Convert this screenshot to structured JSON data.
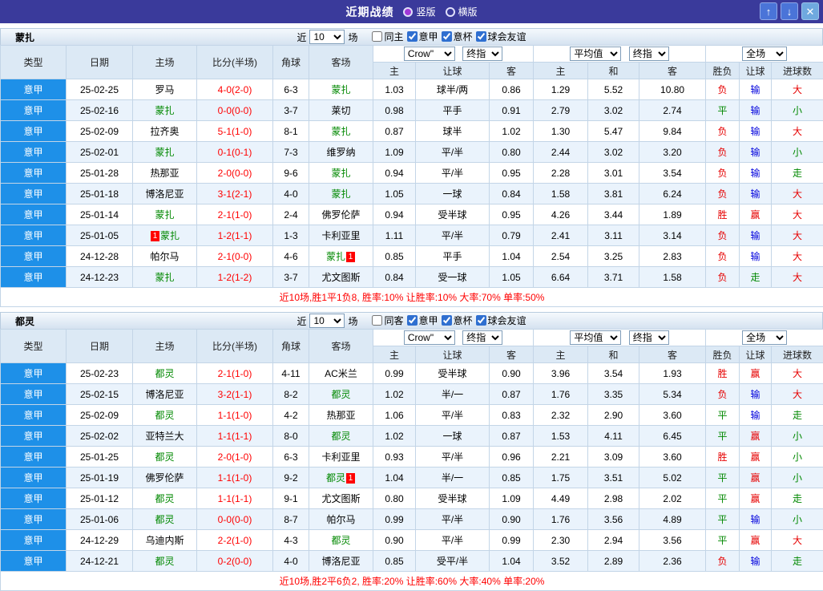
{
  "titlebar": {
    "title": "近期战绩",
    "view_options": [
      {
        "label": "竖版",
        "selected": true
      },
      {
        "label": "横版",
        "selected": false
      }
    ],
    "buttons": {
      "up": "↑",
      "down": "↓",
      "close": "✕"
    }
  },
  "shared": {
    "recent_label": "近",
    "matches_label": "场"
  },
  "columns": [
    "类型",
    "日期",
    "主场",
    "比分(半场)",
    "角球",
    "客场",
    "主",
    "让球",
    "客",
    "主",
    "和",
    "客",
    "胜负",
    "让球",
    "进球数"
  ],
  "colors": {
    "titlebar_bg": "#3A3A9B",
    "league_badge_bg": "#1E90E8",
    "subject_team": "#008800",
    "score_red": "#FF0000",
    "value_colors": {
      "胜": "#E60000",
      "平": "#008800",
      "负": "#E60000",
      "赢": "#E60000",
      "输": "#0000DD",
      "走": "#008800",
      "大": "#E60000",
      "小": "#008800"
    }
  },
  "sections": [
    {
      "team": "蒙扎",
      "filters": {
        "recent_value": "10",
        "checkboxes": [
          {
            "label": "同主",
            "checked": false
          },
          {
            "label": "意甲",
            "checked": true
          },
          {
            "label": "意杯",
            "checked": true
          },
          {
            "label": "球会友谊",
            "checked": true
          }
        ]
      },
      "dropdowns": {
        "handicap_company": "Crow\"",
        "handicap_time": "终指",
        "europe_type": "平均值",
        "europe_time": "终指",
        "scope": "全场"
      },
      "rows": [
        {
          "type": "意甲",
          "date": "25-02-25",
          "home": "罗马",
          "score": "4-0(2-0)",
          "corner": "6-3",
          "away": "蒙扎",
          "ah": [
            "1.03",
            "球半/两",
            "0.86"
          ],
          "eu": [
            "1.29",
            "5.52",
            "10.80"
          ],
          "res": [
            "负",
            "输",
            "大"
          ]
        },
        {
          "type": "意甲",
          "date": "25-02-16",
          "home": "蒙扎",
          "score": "0-0(0-0)",
          "corner": "3-7",
          "away": "莱切",
          "ah": [
            "0.98",
            "平手",
            "0.91"
          ],
          "eu": [
            "2.79",
            "3.02",
            "2.74"
          ],
          "res": [
            "平",
            "输",
            "小"
          ]
        },
        {
          "type": "意甲",
          "date": "25-02-09",
          "home": "拉齐奥",
          "score": "5-1(1-0)",
          "corner": "8-1",
          "away": "蒙扎",
          "ah": [
            "0.87",
            "球半",
            "1.02"
          ],
          "eu": [
            "1.30",
            "5.47",
            "9.84"
          ],
          "res": [
            "负",
            "输",
            "大"
          ]
        },
        {
          "type": "意甲",
          "date": "25-02-01",
          "home": "蒙扎",
          "score": "0-1(0-1)",
          "corner": "7-3",
          "away": "维罗纳",
          "ah": [
            "1.09",
            "平/半",
            "0.80"
          ],
          "eu": [
            "2.44",
            "3.02",
            "3.20"
          ],
          "res": [
            "负",
            "输",
            "小"
          ]
        },
        {
          "type": "意甲",
          "date": "25-01-28",
          "home": "热那亚",
          "score": "2-0(0-0)",
          "corner": "9-6",
          "away": "蒙扎",
          "ah": [
            "0.94",
            "平/半",
            "0.95"
          ],
          "eu": [
            "2.28",
            "3.01",
            "3.54"
          ],
          "res": [
            "负",
            "输",
            "走"
          ]
        },
        {
          "type": "意甲",
          "date": "25-01-18",
          "home": "博洛尼亚",
          "score": "3-1(2-1)",
          "corner": "4-0",
          "away": "蒙扎",
          "ah": [
            "1.05",
            "一球",
            "0.84"
          ],
          "eu": [
            "1.58",
            "3.81",
            "6.24"
          ],
          "res": [
            "负",
            "输",
            "大"
          ]
        },
        {
          "type": "意甲",
          "date": "25-01-14",
          "home": "蒙扎",
          "score": "2-1(1-0)",
          "corner": "2-4",
          "away": "佛罗伦萨",
          "ah": [
            "0.94",
            "受半球",
            "0.95"
          ],
          "eu": [
            "4.26",
            "3.44",
            "1.89"
          ],
          "res": [
            "胜",
            "赢",
            "大"
          ]
        },
        {
          "type": "意甲",
          "date": "25-01-05",
          "home": "蒙扎",
          "home_card": "1",
          "score": "1-2(1-1)",
          "corner": "1-3",
          "away": "卡利亚里",
          "ah": [
            "1.11",
            "平/半",
            "0.79"
          ],
          "eu": [
            "2.41",
            "3.11",
            "3.14"
          ],
          "res": [
            "负",
            "输",
            "大"
          ]
        },
        {
          "type": "意甲",
          "date": "24-12-28",
          "home": "帕尔马",
          "score": "2-1(0-0)",
          "corner": "4-6",
          "away": "蒙扎",
          "away_card": "1",
          "ah": [
            "0.85",
            "平手",
            "1.04"
          ],
          "eu": [
            "2.54",
            "3.25",
            "2.83"
          ],
          "res": [
            "负",
            "输",
            "大"
          ]
        },
        {
          "type": "意甲",
          "date": "24-12-23",
          "home": "蒙扎",
          "score": "1-2(1-2)",
          "corner": "3-7",
          "away": "尤文图斯",
          "ah": [
            "0.84",
            "受一球",
            "1.05"
          ],
          "eu": [
            "6.64",
            "3.71",
            "1.58"
          ],
          "res": [
            "负",
            "走",
            "大"
          ]
        }
      ],
      "summary": "近10场,胜1平1负8, 胜率:10% 让胜率:10% 大率:70% 单率:50%"
    },
    {
      "team": "都灵",
      "filters": {
        "recent_value": "10",
        "checkboxes": [
          {
            "label": "同客",
            "checked": false
          },
          {
            "label": "意甲",
            "checked": true
          },
          {
            "label": "意杯",
            "checked": true
          },
          {
            "label": "球会友谊",
            "checked": true
          }
        ]
      },
      "dropdowns": {
        "handicap_company": "Crow\"",
        "handicap_time": "终指",
        "europe_type": "平均值",
        "europe_time": "终指",
        "scope": "全场"
      },
      "rows": [
        {
          "type": "意甲",
          "date": "25-02-23",
          "home": "都灵",
          "score": "2-1(1-0)",
          "corner": "4-11",
          "away": "AC米兰",
          "ah": [
            "0.99",
            "受半球",
            "0.90"
          ],
          "eu": [
            "3.96",
            "3.54",
            "1.93"
          ],
          "res": [
            "胜",
            "赢",
            "大"
          ]
        },
        {
          "type": "意甲",
          "date": "25-02-15",
          "home": "博洛尼亚",
          "score": "3-2(1-1)",
          "corner": "8-2",
          "away": "都灵",
          "ah": [
            "1.02",
            "半/一",
            "0.87"
          ],
          "eu": [
            "1.76",
            "3.35",
            "5.34"
          ],
          "res": [
            "负",
            "输",
            "大"
          ]
        },
        {
          "type": "意甲",
          "date": "25-02-09",
          "home": "都灵",
          "score": "1-1(1-0)",
          "corner": "4-2",
          "away": "热那亚",
          "ah": [
            "1.06",
            "平/半",
            "0.83"
          ],
          "eu": [
            "2.32",
            "2.90",
            "3.60"
          ],
          "res": [
            "平",
            "输",
            "走"
          ]
        },
        {
          "type": "意甲",
          "date": "25-02-02",
          "home": "亚特兰大",
          "score": "1-1(1-1)",
          "corner": "8-0",
          "away": "都灵",
          "ah": [
            "1.02",
            "一球",
            "0.87"
          ],
          "eu": [
            "1.53",
            "4.11",
            "6.45"
          ],
          "res": [
            "平",
            "赢",
            "小"
          ]
        },
        {
          "type": "意甲",
          "date": "25-01-25",
          "home": "都灵",
          "score": "2-0(1-0)",
          "corner": "6-3",
          "away": "卡利亚里",
          "ah": [
            "0.93",
            "平/半",
            "0.96"
          ],
          "eu": [
            "2.21",
            "3.09",
            "3.60"
          ],
          "res": [
            "胜",
            "赢",
            "小"
          ]
        },
        {
          "type": "意甲",
          "date": "25-01-19",
          "home": "佛罗伦萨",
          "score": "1-1(1-0)",
          "corner": "9-2",
          "away": "都灵",
          "away_card": "1",
          "ah": [
            "1.04",
            "半/一",
            "0.85"
          ],
          "eu": [
            "1.75",
            "3.51",
            "5.02"
          ],
          "res": [
            "平",
            "赢",
            "小"
          ]
        },
        {
          "type": "意甲",
          "date": "25-01-12",
          "home": "都灵",
          "score": "1-1(1-1)",
          "corner": "9-1",
          "away": "尤文图斯",
          "ah": [
            "0.80",
            "受半球",
            "1.09"
          ],
          "eu": [
            "4.49",
            "2.98",
            "2.02"
          ],
          "res": [
            "平",
            "赢",
            "走"
          ]
        },
        {
          "type": "意甲",
          "date": "25-01-06",
          "home": "都灵",
          "score": "0-0(0-0)",
          "corner": "8-7",
          "away": "帕尔马",
          "ah": [
            "0.99",
            "平/半",
            "0.90"
          ],
          "eu": [
            "1.76",
            "3.56",
            "4.89"
          ],
          "res": [
            "平",
            "输",
            "小"
          ]
        },
        {
          "type": "意甲",
          "date": "24-12-29",
          "home": "乌迪内斯",
          "score": "2-2(1-0)",
          "corner": "4-3",
          "away": "都灵",
          "ah": [
            "0.90",
            "平/半",
            "0.99"
          ],
          "eu": [
            "2.30",
            "2.94",
            "3.56"
          ],
          "res": [
            "平",
            "赢",
            "大"
          ]
        },
        {
          "type": "意甲",
          "date": "24-12-21",
          "home": "都灵",
          "score": "0-2(0-0)",
          "corner": "4-0",
          "away": "博洛尼亚",
          "ah": [
            "0.85",
            "受平/半",
            "1.04"
          ],
          "eu": [
            "3.52",
            "2.89",
            "2.36"
          ],
          "res": [
            "负",
            "输",
            "走"
          ]
        }
      ],
      "summary": "近10场,胜2平6负2, 胜率:20% 让胜率:60% 大率:40% 单率:20%"
    }
  ]
}
